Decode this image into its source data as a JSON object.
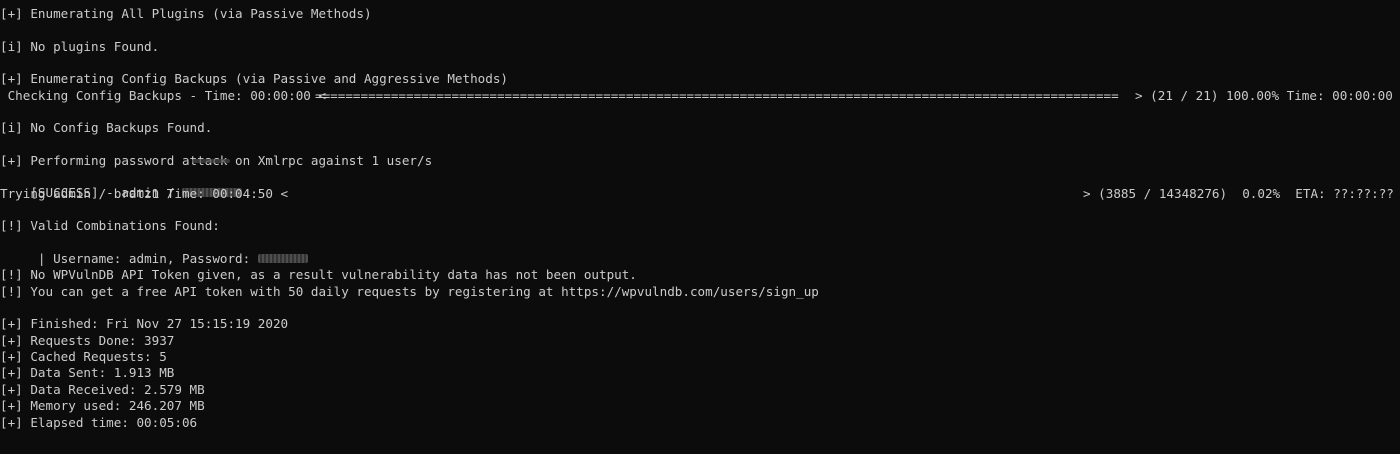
{
  "terminal": {
    "lines": {
      "enum_plugins": "[+] Enumerating All Plugins (via Passive Methods)",
      "no_plugins": "[i] No plugins Found.",
      "enum_config": "[+] Enumerating Config Backups (via Passive and Aggressive Methods)",
      "checking_prefix": " Checking Config Backups - Time: 00:00:00 <",
      "checking_bar": "==========================================================================================================",
      "checking_suffix": "> (21 / 21) 100.00% Time: 00:00:00",
      "no_config": "[i] No Config Backups Found.",
      "password_attack": "[+] Performing password attack on Xmlrpc against 1 user/s",
      "success_prefix": "[SUCCESS] - admin / ",
      "trying_prefix": "Trying admin / bratz1 Time: 00:04:50 <",
      "trying_suffix": "> (3885 / 14348276)  0.02%  ETA: ??:??:??",
      "valid_found": "[!] Valid Combinations Found:",
      "valid_detail": " | Username: admin, Password: ",
      "no_token": "[!] No WPVulnDB API Token given, as a result vulnerability data has not been output.",
      "get_token": "[!] You can get a free API token with 50 daily requests by registering at https://wpvulndb.com/users/sign_up",
      "finished": "[+] Finished: Fri Nov 27 15:15:19 2020",
      "requests_done": "[+] Requests Done: 3937",
      "cached_requests": "[+] Cached Requests: 5",
      "data_sent": "[+] Data Sent: 1.913 MB",
      "data_received": "[+] Data Received: 2.579 MB",
      "memory_used": "[+] Memory used: 246.207 MB",
      "elapsed_time": "[+] Elapsed time: 00:05:06"
    },
    "colors": {
      "background": "#0c0c0c",
      "foreground": "#cccccc"
    }
  }
}
